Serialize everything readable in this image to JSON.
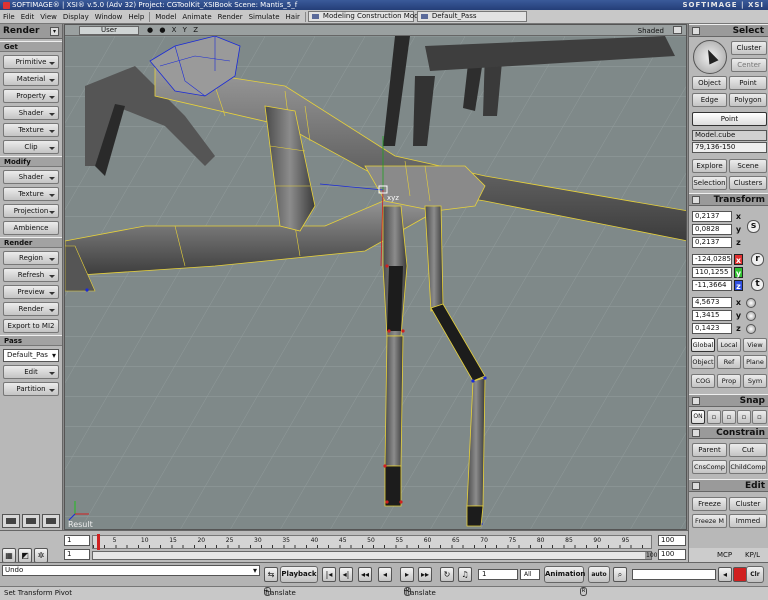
{
  "titlebar": {
    "text": "SOFTIMAGE® | XSI® v.5.0 (Adv 32) Project: CGToolKit_XSIBook   Scene: Mantis_5_f",
    "brand": "SOFTIMAGE | XSI"
  },
  "menubar": {
    "items": [
      "File",
      "Edit",
      "View",
      "Display",
      "Window",
      "Help",
      "Model",
      "Animate",
      "Render",
      "Simulate",
      "Hair"
    ],
    "mode_combo": "Modeling Construction Mode",
    "pass_combo": "Default_Pass"
  },
  "leftpanel": {
    "header": "Render",
    "sections": {
      "get": {
        "title": "Get",
        "buttons": [
          "Primitive",
          "Material",
          "Property",
          "Shader",
          "Texture",
          "Clip"
        ]
      },
      "modify": {
        "title": "Modify",
        "buttons": [
          "Shader",
          "Texture",
          "Projection",
          "Ambience"
        ]
      },
      "render": {
        "title": "Render",
        "buttons": [
          "Region",
          "Refresh",
          "Preview",
          "Render",
          "Export to MI2"
        ]
      },
      "pass": {
        "title": "Pass",
        "dropdown": "Default_Pas",
        "buttons": [
          "Edit",
          "Partition"
        ]
      }
    }
  },
  "viewport": {
    "camera": "User",
    "axis_icons": "●  ●  X  Y  Z",
    "shading": "Shaded",
    "result_label": "Result"
  },
  "rightpanel": {
    "select": {
      "header": "Select",
      "cluster": "Cluster",
      "center": "Center",
      "object": "Object",
      "point": "Point",
      "edge": "Edge",
      "polygon": "Polygon",
      "point_active": "Point",
      "selection_name": "Model.cube",
      "selection_ids": "79,136-150",
      "explore": "Explore",
      "scene": "Scene",
      "selection": "Selection",
      "clusters": "Clusters"
    },
    "transform": {
      "header": "Transform",
      "scale": [
        "0,2137",
        "0,0828",
        "0,2137"
      ],
      "rotate": [
        "-124,0285",
        "110,1255",
        "-11,3664"
      ],
      "translate": [
        "4,5673",
        "1,3415",
        "0,1423"
      ],
      "axes": [
        "x",
        "y",
        "z"
      ],
      "scale_glyph": "s",
      "rotate_glyph": "r",
      "translate_glyph": "t",
      "global": "Global",
      "local": "Local",
      "view": "View",
      "object": "Object",
      "ref": "Ref",
      "plane": "Plane",
      "cog": "COG",
      "prop": "Prop",
      "sym": "Sym"
    },
    "snap": {
      "header": "Snap",
      "on": "ON"
    },
    "constrain": {
      "header": "Constrain",
      "parent": "Parent",
      "cut": "Cut",
      "cnscomp": "CnsComp",
      "childcomp": "ChildComp"
    },
    "edit": {
      "header": "Edit",
      "freeze": "Freeze",
      "cluster": "Cluster",
      "freeze_m": "Freeze M",
      "immed": "Immed"
    },
    "mcp": "MCP",
    "kpl": "KP/L"
  },
  "timeline": {
    "start_top": "1",
    "start_bottom": "1",
    "end_top": "100",
    "end_bottom": "100",
    "range_end": "100",
    "labels": [
      "5",
      "10",
      "15",
      "20",
      "25",
      "30",
      "35",
      "40",
      "45",
      "50",
      "55",
      "60",
      "65",
      "70",
      "75",
      "80",
      "85",
      "90",
      "95"
    ],
    "current_frame": 1,
    "frame_range": [
      1,
      100
    ]
  },
  "cmdbar": {
    "command": "Undo",
    "playback": "Playback",
    "frame": "1",
    "all": "All",
    "animation": "Animation",
    "auto": "auto",
    "clr": "Clr"
  },
  "statusbar": {
    "left": "Set Transform Pivot",
    "l_key": "L",
    "l_text": "Translate Handle",
    "m_key": "M",
    "m_text": "Translate Direction",
    "r_key": "R"
  },
  "colors": {
    "selection_outline": "#e8d23a",
    "wire_blue": "#1a2ad8",
    "model_grey": "#6c6c6c"
  }
}
